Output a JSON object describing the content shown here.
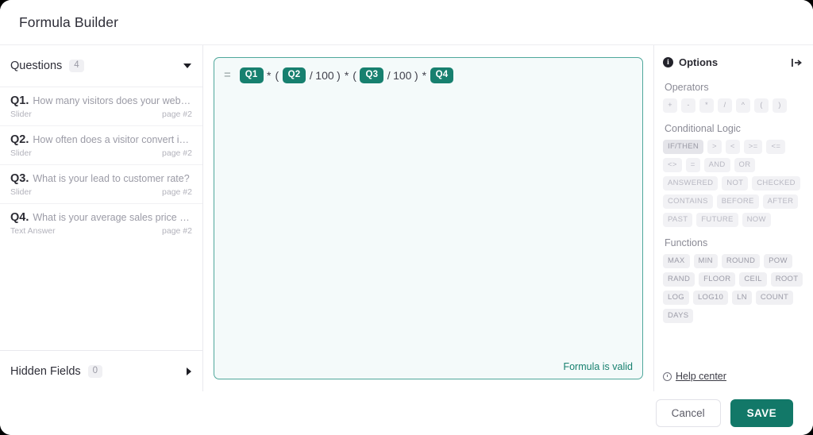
{
  "window": {
    "title": "Formula Builder"
  },
  "sidebar": {
    "questions_section": {
      "label": "Questions",
      "count": "4",
      "toggle_icon": "chevron-down-icon",
      "expanded": true
    },
    "questions": [
      {
        "num": "Q1.",
        "text": "How many visitors does your website have ...",
        "type": "Slider",
        "page": "page #2"
      },
      {
        "num": "Q2.",
        "text": "How often does a visitor convert into a lea...",
        "type": "Slider",
        "page": "page #2"
      },
      {
        "num": "Q3.",
        "text": "What is your lead to customer rate?",
        "type": "Slider",
        "page": "page #2"
      },
      {
        "num": "Q4.",
        "text": "What is your average sales price per custo...",
        "type": "Text Answer",
        "page": "page #2"
      }
    ],
    "hidden_fields_section": {
      "label": "Hidden Fields",
      "count": "0",
      "toggle_icon": "chevron-right-icon",
      "expanded": false
    }
  },
  "editor": {
    "equals_sign": "=",
    "tokens": [
      {
        "kind": "field",
        "text": "Q1"
      },
      {
        "kind": "op",
        "text": "*"
      },
      {
        "kind": "op",
        "text": "("
      },
      {
        "kind": "field",
        "text": "Q2"
      },
      {
        "kind": "op",
        "text": "/"
      },
      {
        "kind": "num",
        "text": "100"
      },
      {
        "kind": "op",
        "text": ")"
      },
      {
        "kind": "op",
        "text": "*"
      },
      {
        "kind": "op",
        "text": "("
      },
      {
        "kind": "field",
        "text": "Q3"
      },
      {
        "kind": "op",
        "text": "/"
      },
      {
        "kind": "num",
        "text": "100"
      },
      {
        "kind": "op",
        "text": ")"
      },
      {
        "kind": "op",
        "text": "*"
      },
      {
        "kind": "field",
        "text": "Q4"
      }
    ],
    "status_message": "Formula is valid",
    "accent_color": "#17806f",
    "border_color": "#4fa79b",
    "background_color": "#f4fafa"
  },
  "options_panel": {
    "title": "Options",
    "info_icon": "info-icon",
    "info_glyph": "i",
    "collapse_icon": "collapse-panel-right-icon",
    "groups": [
      {
        "label": "Operators",
        "style": "op",
        "chips": [
          "+",
          "-",
          "*",
          "/",
          "^",
          "(",
          ")"
        ]
      },
      {
        "label": "Conditional Logic",
        "style": "logic",
        "chips": [
          "IF/THEN",
          ">",
          "<",
          ">=",
          "<=",
          "<>",
          "=",
          "AND",
          "OR",
          "ANSWERED",
          "NOT",
          "CHECKED",
          "CONTAINS",
          "BEFORE",
          "AFTER",
          "PAST",
          "FUTURE",
          "NOW"
        ],
        "active_chip": "IF/THEN"
      },
      {
        "label": "Functions",
        "style": "fn",
        "chips": [
          "MAX",
          "MIN",
          "ROUND",
          "POW",
          "RAND",
          "FLOOR",
          "CEIL",
          "ROOT",
          "LOG",
          "LOG10",
          "LN",
          "COUNT",
          "DAYS"
        ]
      }
    ],
    "help": {
      "icon": "help-clock-icon",
      "label": "Help center"
    }
  },
  "footer": {
    "cancel_label": "Cancel",
    "save_label": "SAVE",
    "save_color": "#127868"
  }
}
